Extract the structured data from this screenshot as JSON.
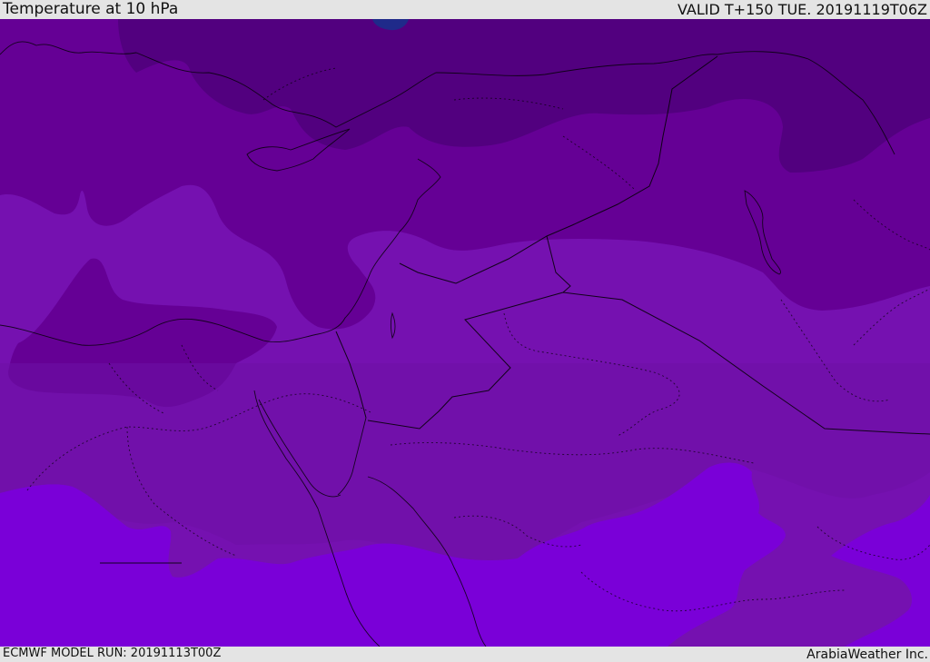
{
  "header": {
    "title": "Temperature at 10 hPa",
    "valid": "VALID T+150 TUE. 20191119T06Z"
  },
  "footer": {
    "model_run": "ECMWF MODEL RUN: 20191113T00Z",
    "credit": "ArabiaWeather Inc."
  },
  "map": {
    "colors": {
      "darkest": "#1f2a8a",
      "band_1": "#52007f",
      "band_2": "#650095",
      "band_3": "#7511b0",
      "band_4": "#7a00d8",
      "land_band": "#6e10a6"
    }
  }
}
